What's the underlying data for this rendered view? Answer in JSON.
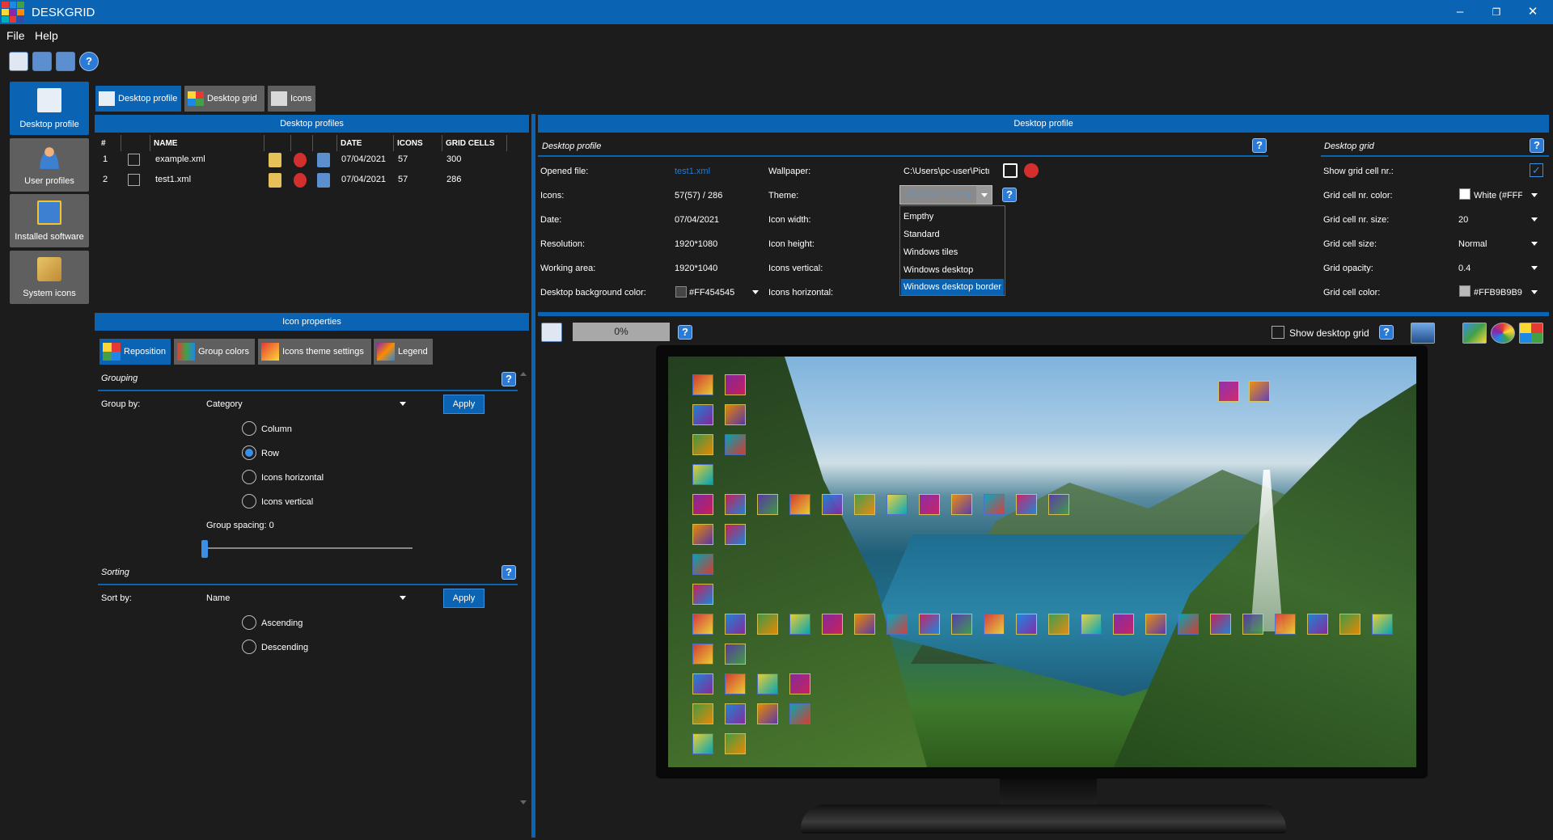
{
  "app": {
    "title": "DESKGRID"
  },
  "menu": [
    "File",
    "Help"
  ],
  "nav": {
    "desktop_profile": "Desktop profile",
    "user_profiles": "User profiles",
    "installed_software": "Installed software",
    "system_icons": "System icons"
  },
  "tabs": {
    "desktop_profile": "Desktop profile",
    "desktop_grid": "Desktop grid",
    "icons": "Icons"
  },
  "profiles_panel": {
    "header": "Desktop profiles",
    "columns": [
      "#",
      "NAME",
      "DATE",
      "ICONS",
      "GRID CELLS"
    ],
    "rows": [
      {
        "num": "1",
        "name": "example.xml",
        "date": "07/04/2021",
        "icons": "57",
        "grid_cells": "300"
      },
      {
        "num": "2",
        "name": "test1.xml",
        "date": "07/04/2021",
        "icons": "57",
        "grid_cells": "286"
      }
    ]
  },
  "icon_properties": {
    "header": "Icon properties",
    "tabs": [
      "Reposition",
      "Group colors",
      "Icons theme settings",
      "Legend"
    ],
    "grouping": {
      "title": "Grouping",
      "group_by_label": "Group by:",
      "group_by_value": "Category",
      "apply": "Apply",
      "options": [
        "Column",
        "Row",
        "Icons horizontal",
        "Icons vertical"
      ],
      "selected": "Row",
      "spacing_label": "Group spacing: 0",
      "spacing_value": 0
    },
    "sorting": {
      "title": "Sorting",
      "sort_by_label": "Sort by:",
      "sort_by_value": "Name",
      "apply": "Apply",
      "options": [
        "Ascending",
        "Descending"
      ]
    }
  },
  "desktop_profile_panel": {
    "header": "Desktop profile",
    "subtitle": "Desktop profile",
    "opened_file_label": "Opened file:",
    "opened_file": "test1.xml",
    "icons_label": "Icons:",
    "icons": "57(57) / 286",
    "date_label": "Date:",
    "date": "07/04/2021",
    "resolution_label": "Resolution:",
    "resolution": "1920*1080",
    "working_area_label": "Working area:",
    "working_area": "1920*1040",
    "bg_color_label": "Desktop background color:",
    "bg_color": "#FF454545",
    "wallpaper_label": "Wallpaper:",
    "wallpaper": "C:\\Users\\pc-user\\Pictu",
    "theme_label": "Theme:",
    "theme_value": "Windows desktop border",
    "icon_width_label": "Icon width:",
    "icon_height_label": "Icon height:",
    "icons_vertical_label": "Icons vertical:",
    "icons_horizontal_label": "Icons horizontal:",
    "theme_options": [
      "Empthy",
      "Standard",
      "Windows tiles",
      "Windows desktop",
      "Windows desktop border"
    ],
    "theme_selected_index": 4
  },
  "desktop_grid_panel": {
    "subtitle": "Desktop grid",
    "show_cell_nr_label": "Show grid cell nr.:",
    "show_cell_nr": true,
    "cell_nr_color_label": "Grid cell nr. color:",
    "cell_nr_color": "White (#FFF",
    "cell_nr_size_label": "Grid cell nr. size:",
    "cell_nr_size": "20",
    "cell_size_label": "Grid cell size:",
    "cell_size": "Normal",
    "opacity_label": "Grid opacity:",
    "opacity": "0.4",
    "cell_color_label": "Grid cell color:",
    "cell_color": "#FFB9B9B9"
  },
  "preview": {
    "progress": "0%",
    "progress_value": 0,
    "show_grid_label": "Show desktop grid"
  },
  "colors": {
    "accent": "#0a63b3",
    "bg": "#1c1c1c",
    "button": "#5f5f5f"
  }
}
